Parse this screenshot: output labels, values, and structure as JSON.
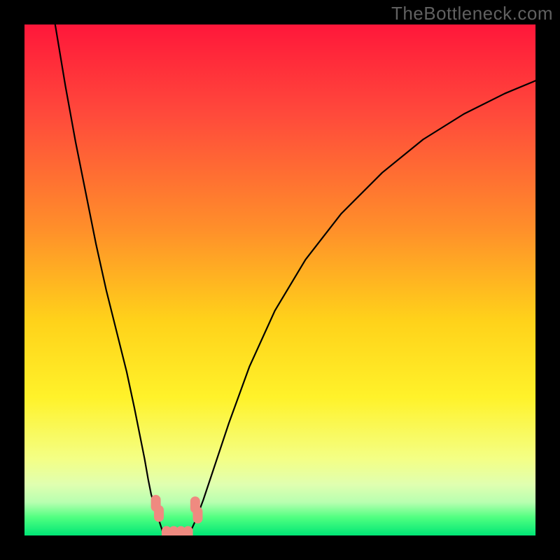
{
  "watermark": "TheBottleneck.com",
  "chart_data": {
    "type": "line",
    "title": "",
    "xlabel": "",
    "ylabel": "",
    "xlim": [
      0,
      100
    ],
    "ylim": [
      0,
      100
    ],
    "gradient_stops": [
      {
        "offset": 0,
        "color": "#ff173a"
      },
      {
        "offset": 0.18,
        "color": "#ff4b3b"
      },
      {
        "offset": 0.4,
        "color": "#ff8f2a"
      },
      {
        "offset": 0.58,
        "color": "#ffd21a"
      },
      {
        "offset": 0.73,
        "color": "#fff22a"
      },
      {
        "offset": 0.85,
        "color": "#f4ff85"
      },
      {
        "offset": 0.9,
        "color": "#e0ffb0"
      },
      {
        "offset": 0.935,
        "color": "#b8ffb0"
      },
      {
        "offset": 0.965,
        "color": "#4fff80"
      },
      {
        "offset": 1.0,
        "color": "#00e676"
      }
    ],
    "series": [
      {
        "name": "left-branch",
        "x": [
          6,
          8,
          10,
          12,
          14,
          16,
          18,
          20,
          21.5,
          22.5,
          23.5,
          24.2,
          24.8,
          25.4,
          25.8,
          26.2,
          26.5,
          26.8,
          27.0
        ],
        "y": [
          100,
          88,
          77,
          67,
          57,
          48,
          40,
          32,
          25,
          20,
          15,
          11,
          8,
          6,
          4.5,
          3.3,
          2.4,
          1.5,
          0.8
        ]
      },
      {
        "name": "valley-floor",
        "x": [
          27.0,
          28.0,
          29.5,
          31.0,
          32.5
        ],
        "y": [
          0.8,
          0.3,
          0.2,
          0.3,
          0.8
        ]
      },
      {
        "name": "right-branch",
        "x": [
          32.5,
          33.5,
          35,
          37,
          40,
          44,
          49,
          55,
          62,
          70,
          78,
          86,
          94,
          100
        ],
        "y": [
          0.8,
          3,
          7,
          13,
          22,
          33,
          44,
          54,
          63,
          71,
          77.5,
          82.5,
          86.5,
          89
        ]
      }
    ],
    "marker_clusters": [
      {
        "name": "left-top-pair",
        "color": "#ef8a80",
        "points": [
          {
            "x": 25.7,
            "y": 6.3
          },
          {
            "x": 26.3,
            "y": 4.3
          }
        ]
      },
      {
        "name": "right-top-pair",
        "color": "#ef8a80",
        "points": [
          {
            "x": 33.4,
            "y": 6.0
          },
          {
            "x": 33.9,
            "y": 4.0
          }
        ]
      },
      {
        "name": "bottom-bar",
        "color": "#ef8a80",
        "points": [
          {
            "x": 27.8,
            "y": 0.2
          },
          {
            "x": 29.2,
            "y": 0.2
          },
          {
            "x": 30.6,
            "y": 0.2
          },
          {
            "x": 32.0,
            "y": 0.2
          }
        ]
      }
    ]
  }
}
